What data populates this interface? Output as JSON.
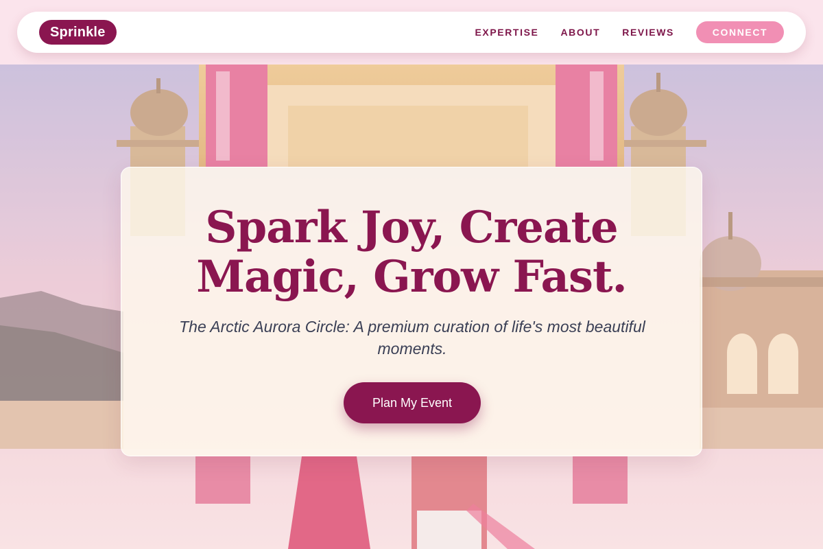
{
  "brand": {
    "name": "Sprinkle"
  },
  "nav": {
    "links": [
      "EXPERTISE",
      "ABOUT",
      "REVIEWS"
    ],
    "cta": "CONNECT"
  },
  "hero": {
    "headline_line1": "Spark Joy, Create",
    "headline_line2": "Magic, Grow Fast.",
    "subtitle": "The Arctic Aurora Circle: A premium curation of life's most beautiful moments.",
    "cta": "Plan My Event",
    "background_image": "palace-wedding-photo"
  },
  "colors": {
    "brand": "#8a1650",
    "accent": "#f18fb4",
    "page_bg": "#fbe4ec",
    "subtitle_text": "#3a3f55"
  }
}
